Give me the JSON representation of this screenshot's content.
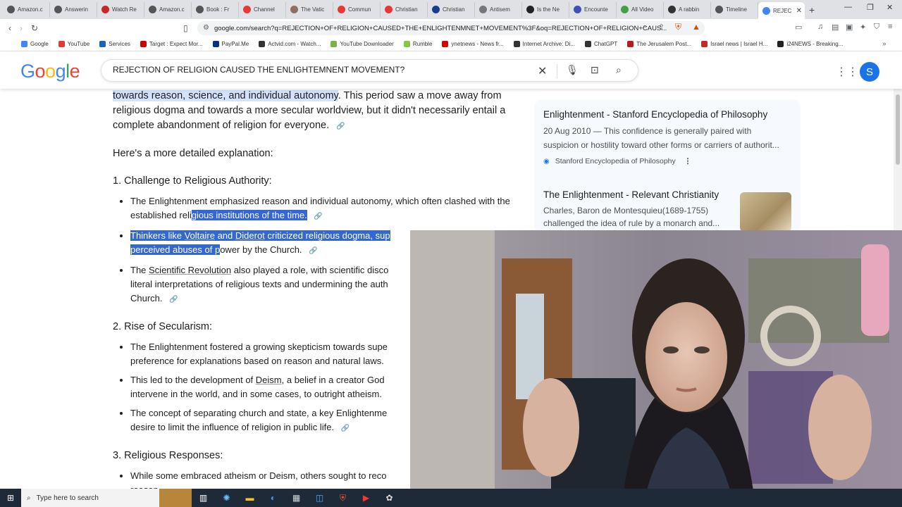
{
  "browser": {
    "tabs": [
      {
        "label": "Amazon.c",
        "color": "#555"
      },
      {
        "label": "Answerin",
        "color": "#555"
      },
      {
        "label": "Watch Re",
        "color": "#c62828"
      },
      {
        "label": "Amazon.c",
        "color": "#555"
      },
      {
        "label": "Book : Fr",
        "color": "#555"
      },
      {
        "label": "Channel",
        "color": "#e53935"
      },
      {
        "label": "The Vatic",
        "color": "#8d6e63"
      },
      {
        "label": "Commun",
        "color": "#e53935"
      },
      {
        "label": "Christian",
        "color": "#e53935"
      },
      {
        "label": "Christian",
        "color": "#1a3e8c"
      },
      {
        "label": "Antisem",
        "color": "#777"
      },
      {
        "label": "Is the Ne",
        "color": "#222"
      },
      {
        "label": "Encounte",
        "color": "#3f51b5"
      },
      {
        "label": "All Video",
        "color": "#43a047"
      },
      {
        "label": "A rabbin",
        "color": "#333"
      },
      {
        "label": "Timeline",
        "color": "#555"
      },
      {
        "label": "REJEC",
        "color": "#4285f4",
        "active": true
      }
    ],
    "url": "google.com/search?q=REJECTION+OF+RELIGION+CAUSED+THE+ENLIGHTENMNET+MOVEMENT%3F&oq=REJECTION+OF+RELIGION+CAUS...",
    "bookmarks": [
      {
        "label": "Google",
        "color": "#4285f4"
      },
      {
        "label": "YouTube",
        "color": "#e53935"
      },
      {
        "label": "Services",
        "color": "#1565c0"
      },
      {
        "label": "Target : Expect Mor...",
        "color": "#cc0000"
      },
      {
        "label": "PayPal.Me",
        "color": "#003087"
      },
      {
        "label": "Actvid.com - Watch...",
        "color": "#333"
      },
      {
        "label": "YouTube Downloader",
        "color": "#7cb342"
      },
      {
        "label": "Rumble",
        "color": "#85c742"
      },
      {
        "label": "ynetnews - News fr...",
        "color": "#d50000"
      },
      {
        "label": "Internet Archive: Di...",
        "color": "#333"
      },
      {
        "label": "ChatGPT",
        "color": "#333"
      },
      {
        "label": "The Jerusalem Post...",
        "color": "#b71c1c"
      },
      {
        "label": "Israel news | Israel H...",
        "color": "#c62828"
      },
      {
        "label": "i24NEWS - Breaking...",
        "color": "#222"
      }
    ]
  },
  "search": {
    "logo": "Google",
    "query": "REJECTION OF RELIGION CAUSED THE ENLIGHTEMNENT MOVEMENT?",
    "avatar_letter": "S"
  },
  "overview": {
    "intro_highlight": "towards reason, science, and individual autonomy",
    "intro_rest": ". This period saw a move away from religious dogma and towards a more secular worldview, but it didn't necessarily entail a complete abandonment of religion for everyone.",
    "detail_intro": "Here's a more detailed explanation:",
    "section1_title": "1. Challenge to Religious Authority:",
    "s1_b1_plain": "The Enlightenment emphasized reason and individual autonomy, which often clashed with the established reli",
    "s1_b1_selected": "gious institutions of the time.",
    "s1_b2_sel1": "Thinkers like ",
    "s1_b2_voltaire": "Voltaire",
    "s1_b2_and": " and ",
    "s1_b2_diderot": "Diderot",
    "s1_b2_sel2": " criticized religious dogma, sup",
    "s1_b2_sel3": "perceived abuses of p",
    "s1_b2_rest": "ower by the Church.",
    "s1_b3_a": "The ",
    "s1_b3_link": "Scientific Revolution",
    "s1_b3_b": " also played a role, with scientific disco",
    "s1_b3_c": "literal interpretations of religious texts and undermining the auth",
    "s1_b3_d": "Church.",
    "section2_title": "2. Rise of Secularism:",
    "s2_b1_a": "The Enlightenment fostered a growing skepticism towards supe",
    "s2_b1_b": "preference for explanations based on reason and natural laws.",
    "s2_b2_a": "This led to the development of ",
    "s2_b2_link": "Deism",
    "s2_b2_b": ", a belief in a creator God",
    "s2_b2_c": "intervene in the world, and in some cases, to outright atheism.",
    "s2_b3_a": "The concept of separating church and state, a key Enlightenme",
    "s2_b3_b": "desire to limit the influence of religion in public life.",
    "section3_title": "3. Religious Responses:",
    "s3_b1_a": "While some embraced atheism or Deism, others sought to reco",
    "s3_b1_b": "reason"
  },
  "sources": [
    {
      "title": "Enlightenment - Stanford Encyclopedia of Philosophy",
      "snippet1": "20 Aug 2010 — This confidence is generally paired with",
      "snippet2": "suspicion or hostility toward other forms or carriers of authorit...",
      "site": "Stanford Encyclopedia of Philosophy"
    },
    {
      "title": "The Enlightenment - Relevant Christianity",
      "snippet1": "Charles, Baron de Montesquieu(1689-1755)",
      "snippet2": "challenged the idea of rule by a monarch and..."
    }
  ],
  "taskbar": {
    "search_placeholder": "Type here to search"
  }
}
